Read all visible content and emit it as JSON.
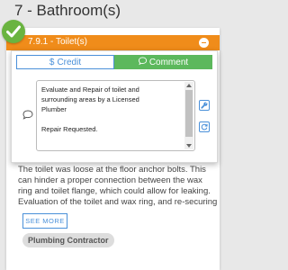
{
  "section": {
    "title": "7 - Bathroom(s)"
  },
  "item": {
    "header_label": "7.9.1 - Toilet(s)",
    "description": "The toilet was loose at the floor anchor bolts. This can hinder a proper connection between the wax ring and toilet flange, which could allow for leaking. Evaluation of the toilet and wax ring, and re-securing as needed to",
    "see_more_label": "SEE MORE",
    "tag": "Plumbing Contractor"
  },
  "popup": {
    "tabs": [
      {
        "label": "Credit",
        "icon": "dollar-icon"
      },
      {
        "label": "Comment",
        "icon": "chat-bubble-icon"
      }
    ],
    "note_text": "Evaluate and Repair of toilet and\nsurrounding areas by a Licensed\nPlumber\n\nRepair Requested.",
    "side_buttons": [
      "wrench-icon",
      "refresh-icon"
    ]
  },
  "colors": {
    "header": "#f08c1a",
    "check": "#6ab440",
    "accent": "#4a90d9",
    "comment_tab": "#5cb85c"
  }
}
